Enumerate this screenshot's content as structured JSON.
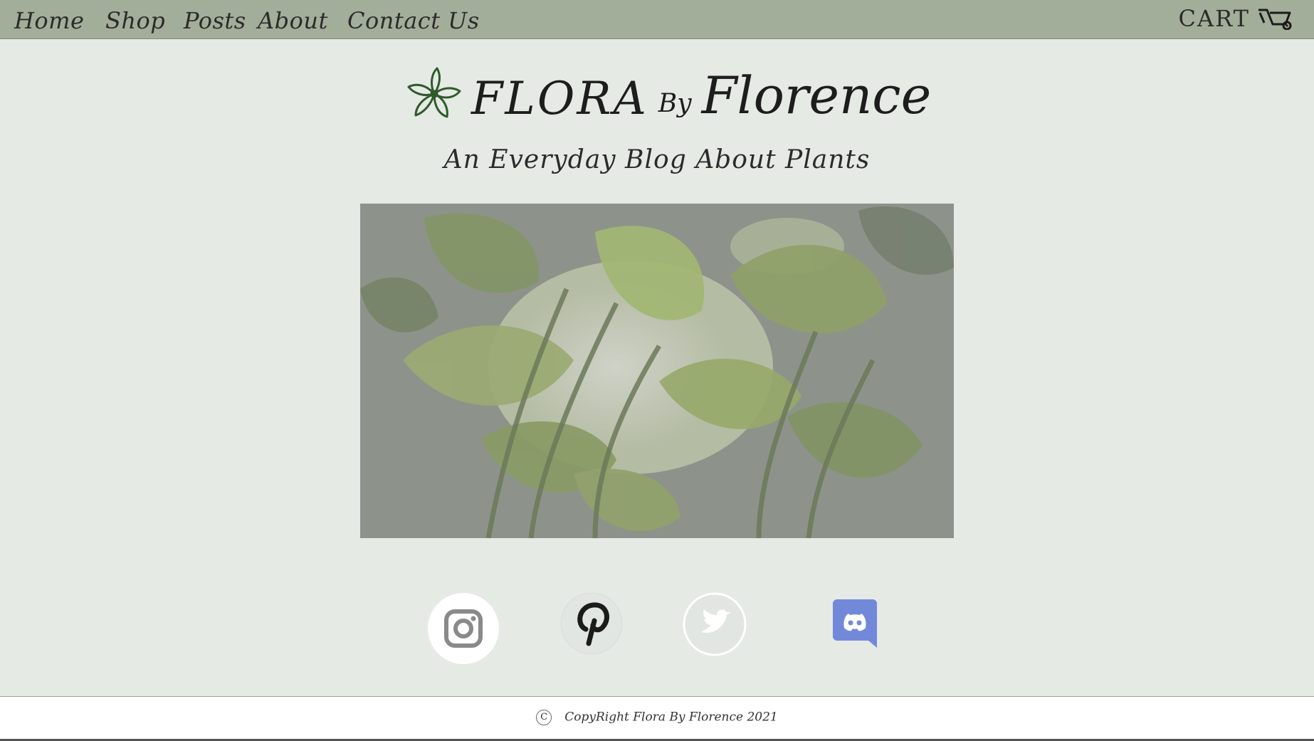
{
  "nav": {
    "links": [
      {
        "label": "Home"
      },
      {
        "label": "Shop"
      },
      {
        "label": "Posts"
      },
      {
        "label": "About"
      },
      {
        "label": "Contact Us"
      }
    ],
    "cart_label": "CART",
    "cart_icon": "wheelbarrow-icon"
  },
  "brand": {
    "logo_icon": "flower-icon",
    "name_part1": "FLORA",
    "name_by": "By",
    "name_part2": "Florence",
    "tagline": "An Everyday Blog About Plants"
  },
  "hero": {
    "image": "tropical-leaves-photo"
  },
  "socials": [
    {
      "icon": "instagram-icon",
      "color": "#ffffff"
    },
    {
      "icon": "pinterest-icon",
      "color": "#1b1b1b"
    },
    {
      "icon": "twitter-icon",
      "color": "#ffffff"
    },
    {
      "icon": "discord-icon",
      "color": "#7289da"
    }
  ],
  "footer": {
    "copyright_symbol": "C",
    "text": "CopyRight Flora By Florence 2021"
  },
  "colors": {
    "navbar": "#a3ae9a",
    "background": "#e5eae5",
    "footer": "#ffffff",
    "logo_green": "#2f5a2a"
  }
}
